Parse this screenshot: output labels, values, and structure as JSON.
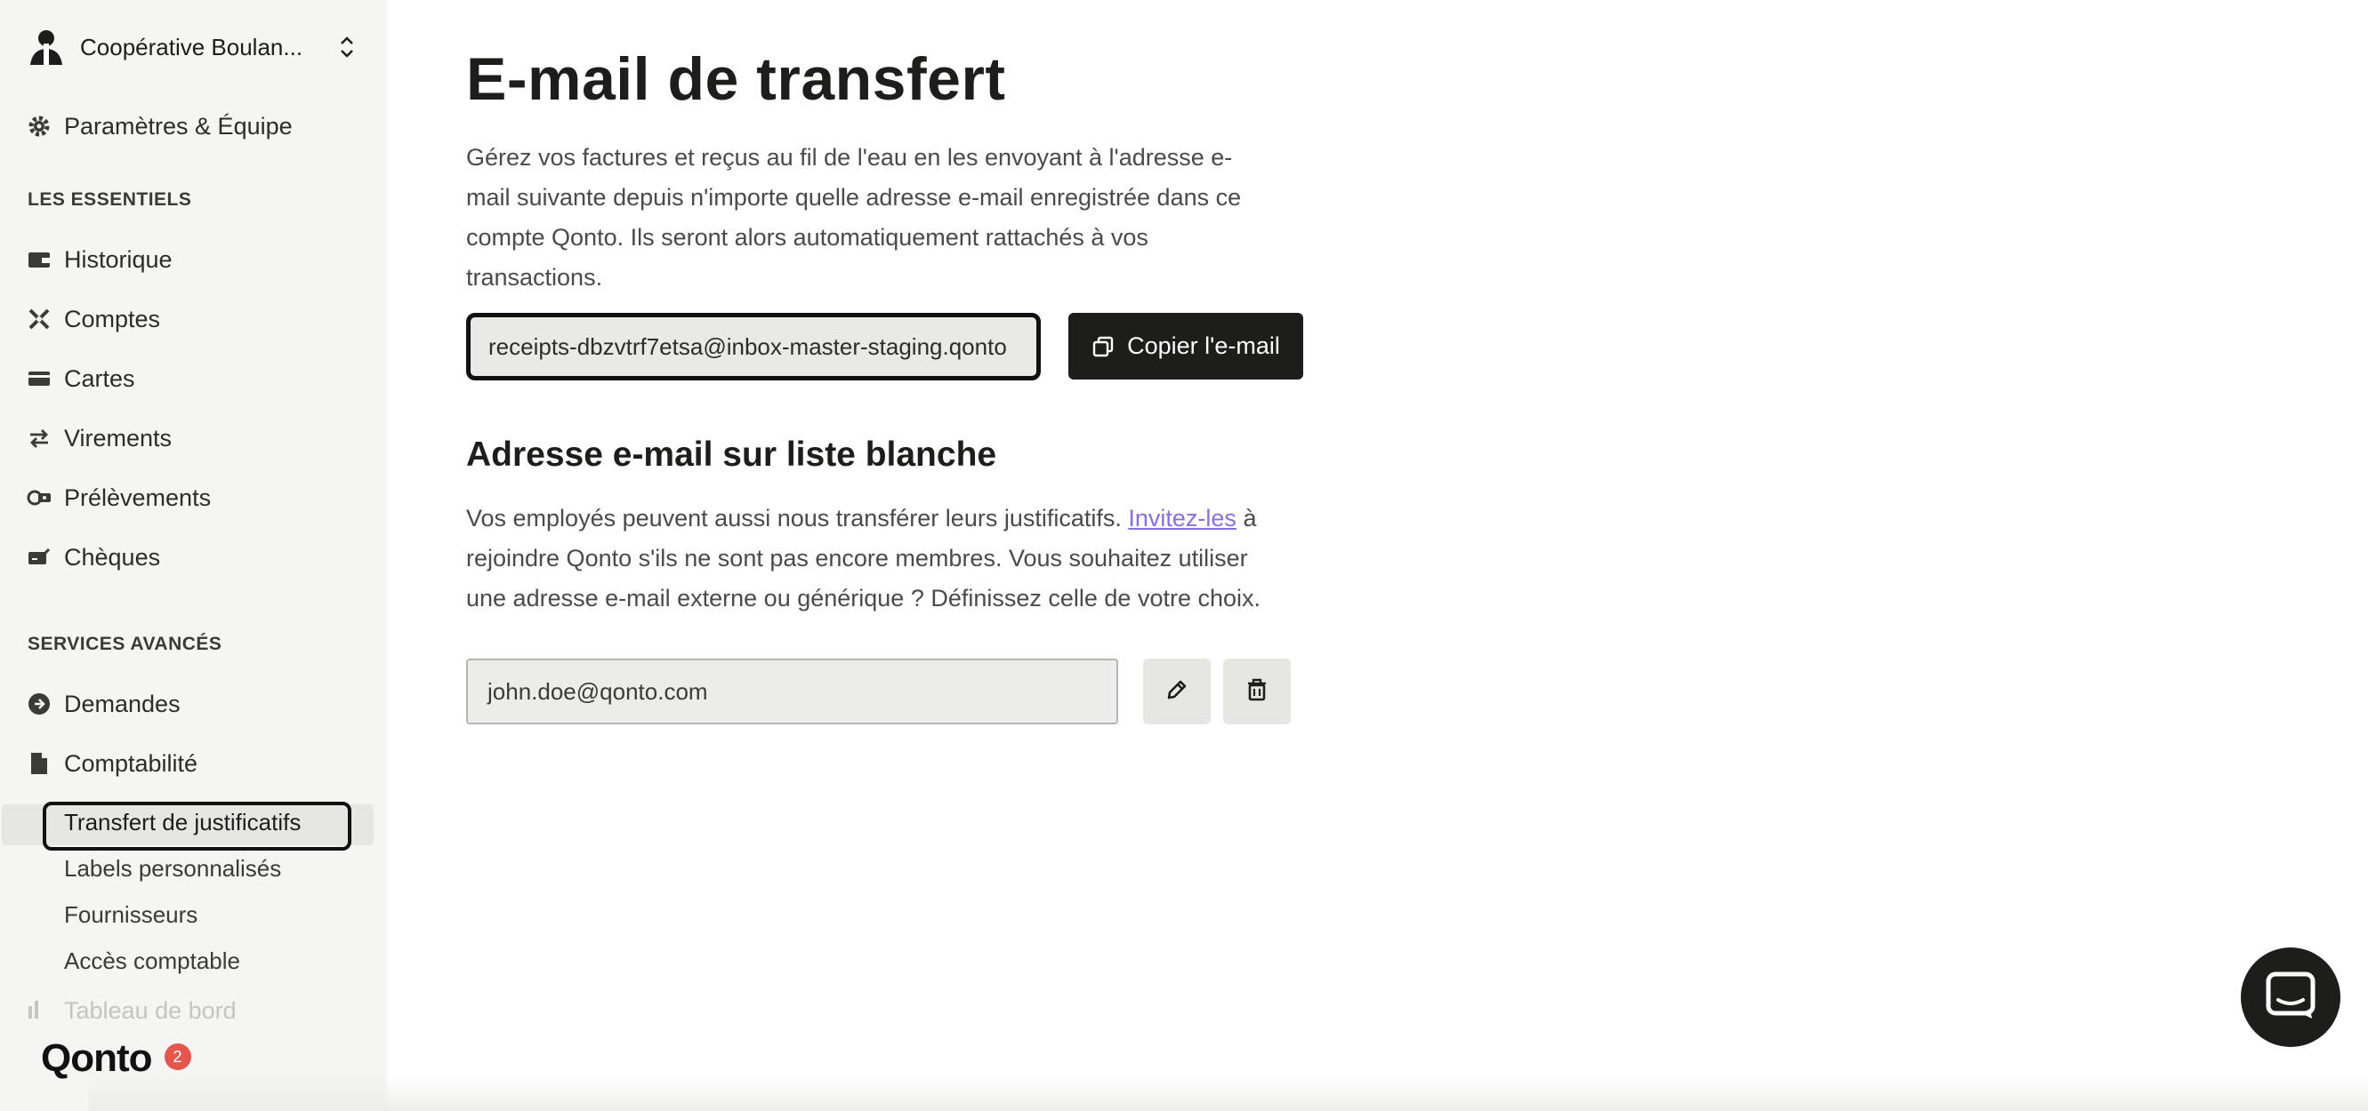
{
  "org": {
    "name": "Coopérative Boulan..."
  },
  "sidebar": {
    "settings_label": "Paramètres & Équipe",
    "section_essentials": "LES ESSENTIELS",
    "essentials": [
      {
        "label": "Historique",
        "icon": "wallet-icon"
      },
      {
        "label": "Comptes",
        "icon": "accounts-icon"
      },
      {
        "label": "Cartes",
        "icon": "card-icon"
      },
      {
        "label": "Virements",
        "icon": "transfer-icon"
      },
      {
        "label": "Prélèvements",
        "icon": "direct-debit-icon"
      },
      {
        "label": "Chèques",
        "icon": "check-icon"
      }
    ],
    "section_advanced": "SERVICES AVANCÉS",
    "advanced": [
      {
        "label": "Demandes",
        "icon": "requests-icon"
      },
      {
        "label": "Comptabilité",
        "icon": "accounting-icon"
      }
    ],
    "accounting_sub": [
      "Transfert de justificatifs",
      "Labels personnalisés",
      "Fournisseurs",
      "Accès comptable"
    ],
    "faded_item": "Tableau de bord",
    "logo": "Qonto",
    "badge_count": "2"
  },
  "main": {
    "title": "E-mail de transfert",
    "description": "Gérez vos factures et reçus au fil de l'eau en les envoyant à l'adresse e-mail suivante depuis n'importe quelle adresse e-mail enregistrée dans ce compte Qonto. Ils seront alors automatiquement rattachés à vos transactions.",
    "transfer_email": "receipts-dbzvtrf7etsa@inbox-master-staging.qonto",
    "copy_button": "Copier l'e-mail",
    "whitelist_title": "Adresse e-mail sur liste blanche",
    "whitelist_desc_before": "Vos employés peuvent aussi nous transférer leurs justificatifs.",
    "whitelist_link": "Invitez-les",
    "whitelist_desc_after": "à rejoindre Qonto s'ils ne sont pas encore membres. Vous souhaitez utiliser une adresse e-mail externe ou générique ? Définissez celle de votre choix.",
    "whitelist_email": "john.doe@qonto.com"
  },
  "colors": {
    "primary": "#1d1d1b",
    "sidebar_bg": "#f5f5f3",
    "link": "#8a6fd8",
    "badge": "#e5574e"
  }
}
